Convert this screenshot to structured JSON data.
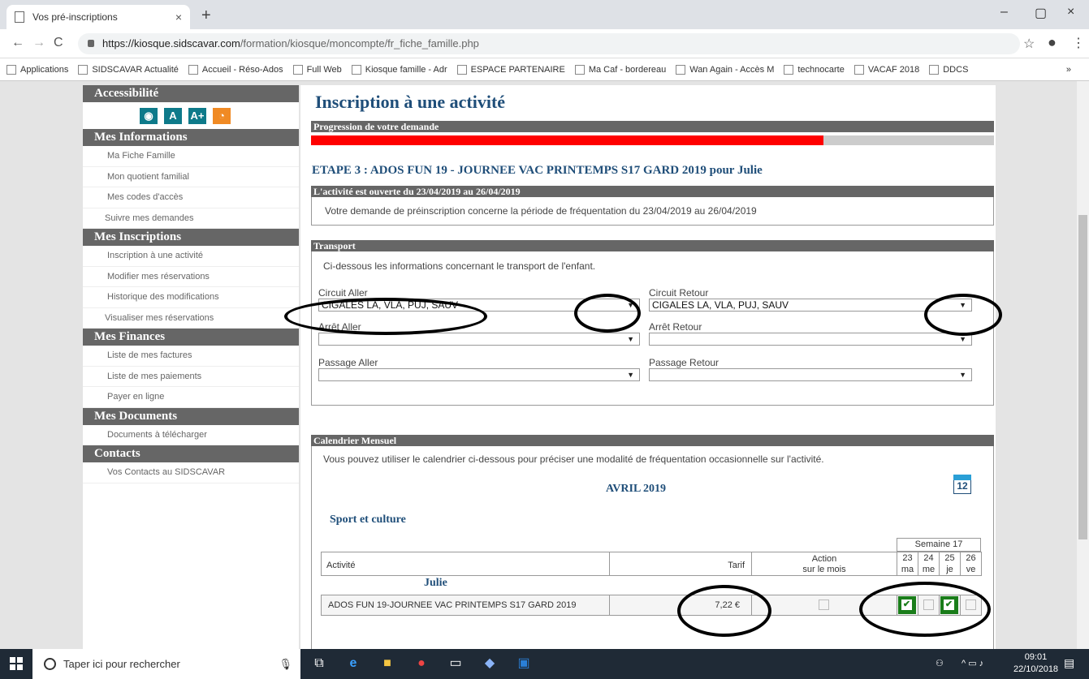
{
  "browser": {
    "tab_title": "Vos pré-inscriptions",
    "tab_close": "×",
    "new_tab": "+",
    "url_host": "https://kiosque.sidscavar.com",
    "url_path": "/formation/kiosque/moncompte/fr_fiche_famille.php",
    "win_min": "–",
    "win_max": "▢",
    "win_close": "×",
    "back": "←",
    "forward": "→",
    "reload": "C",
    "star": "☆",
    "kebab": "⋮",
    "bookmarks": [
      "Applications",
      "SIDSCAVAR Actualité",
      "Accueil - Réso-Ados",
      "Full Web",
      "Kiosque famille - Adr",
      "ESPACE PARTENAIRE",
      "Ma Caf - bordereau",
      "Wan Again - Accès M",
      "technocarte",
      "VACAF 2018",
      "DDCS"
    ],
    "bookmarks_more": "»"
  },
  "sidebar": {
    "accessibilite": "Accessibilité",
    "acc_icons": [
      "eye-icon",
      "font-smaller-icon",
      "font-larger-icon",
      "rss-icon"
    ],
    "acc_glyphs": [
      "◉",
      "A",
      "A+",
      "◔"
    ],
    "sections": [
      {
        "title": "Mes Informations",
        "items": [
          "Ma Fiche Famille",
          "Mon quotient familial",
          "Mes codes d'accès",
          "Suivre mes demandes"
        ]
      },
      {
        "title": "Mes Inscriptions",
        "items": [
          "Inscription à une activité",
          "Modifier mes réservations",
          "Historique des modifications",
          "Visualiser mes réservations"
        ]
      },
      {
        "title": "Mes Finances",
        "items": [
          "Liste de mes factures",
          "Liste de mes paiements",
          "Payer en ligne"
        ]
      },
      {
        "title": "Mes Documents",
        "items": [
          "Documents à télécharger"
        ]
      },
      {
        "title": "Contacts",
        "items": [
          "Vos Contacts au SIDSCAVAR"
        ]
      }
    ]
  },
  "main": {
    "title": "Inscription à une activité",
    "progress_header": "Progression de votre demande",
    "progress_pct": 75,
    "etape": "ETAPE 3 : ADOS FUN 19 - JOURNEE VAC PRINTEMPS S17 GARD 2019 pour Julie",
    "open_header": "L'activité est ouverte du 23/04/2019 au 26/04/2019",
    "open_text": "Votre demande de préinscription concerne la période de fréquentation du 23/04/2019 au 26/04/2019",
    "transport_header": "Transport",
    "transport_text": "Ci-dessous les informations concernant le transport de l'enfant.",
    "circuit_aller_label": "Circuit Aller",
    "circuit_aller_value": "CIGALES LA, VLA, PUJ, SAUV",
    "circuit_retour_label": "Circuit Retour",
    "circuit_retour_value": "CIGALES LA, VLA, PUJ, SAUV",
    "arret_aller_label": "Arrêt Aller",
    "arret_retour_label": "Arrêt Retour",
    "passage_aller_label": "Passage Aller",
    "passage_retour_label": "Passage Retour",
    "select_arrow": "▼",
    "calendar_header": "Calendrier Mensuel",
    "calendar_text": "Vous pouvez utiliser le calendrier ci-dessous pour préciser une modalité de fréquentation occasionnelle sur l'activité.",
    "month": "AVRIL 2019",
    "calendar_icon_day": "12",
    "category": "Sport et culture",
    "table": {
      "week": "Semaine 17",
      "col_activite": "Activité",
      "col_tarif": "Tarif",
      "col_action": "Action",
      "col_action2": "sur le mois",
      "days": [
        {
          "num": "23",
          "abbr": "ma",
          "checked": true
        },
        {
          "num": "24",
          "abbr": "me",
          "checked": false
        },
        {
          "num": "25",
          "abbr": "je",
          "checked": true
        },
        {
          "num": "26",
          "abbr": "ve",
          "checked": false
        }
      ],
      "child": "Julie",
      "row_activity": "ADOS FUN 19-JOURNEE VAC PRINTEMPS S17 GARD 2019",
      "row_tarif": "7,22 €"
    }
  },
  "taskbar": {
    "search": "Taper ici pour rechercher",
    "time": "09:01",
    "date": "22/10/2018"
  }
}
